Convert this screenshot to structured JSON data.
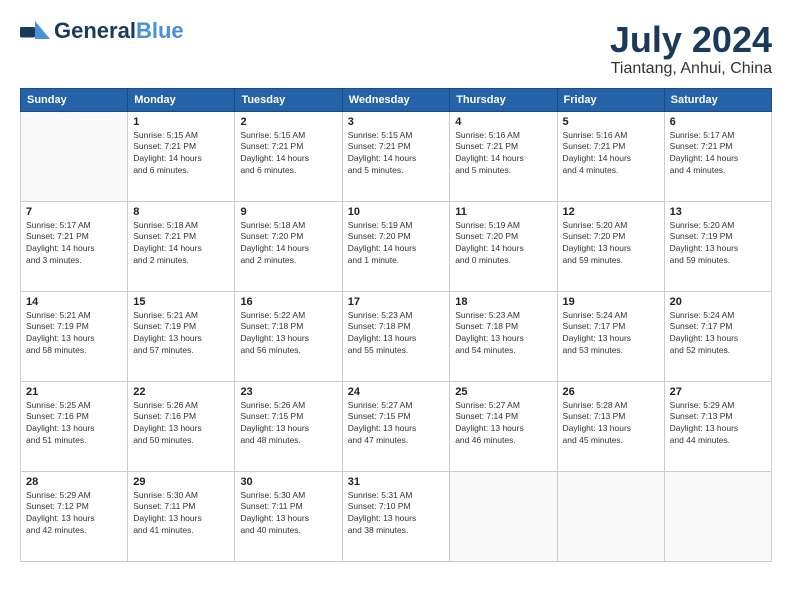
{
  "header": {
    "logo_main": "General",
    "logo_sub": "Blue",
    "month_year": "July 2024",
    "location": "Tiantang, Anhui, China"
  },
  "days_of_week": [
    "Sunday",
    "Monday",
    "Tuesday",
    "Wednesday",
    "Thursday",
    "Friday",
    "Saturday"
  ],
  "weeks": [
    [
      {
        "day": "",
        "info": ""
      },
      {
        "day": "1",
        "info": "Sunrise: 5:15 AM\nSunset: 7:21 PM\nDaylight: 14 hours\nand 6 minutes."
      },
      {
        "day": "2",
        "info": "Sunrise: 5:15 AM\nSunset: 7:21 PM\nDaylight: 14 hours\nand 6 minutes."
      },
      {
        "day": "3",
        "info": "Sunrise: 5:15 AM\nSunset: 7:21 PM\nDaylight: 14 hours\nand 5 minutes."
      },
      {
        "day": "4",
        "info": "Sunrise: 5:16 AM\nSunset: 7:21 PM\nDaylight: 14 hours\nand 5 minutes."
      },
      {
        "day": "5",
        "info": "Sunrise: 5:16 AM\nSunset: 7:21 PM\nDaylight: 14 hours\nand 4 minutes."
      },
      {
        "day": "6",
        "info": "Sunrise: 5:17 AM\nSunset: 7:21 PM\nDaylight: 14 hours\nand 4 minutes."
      }
    ],
    [
      {
        "day": "7",
        "info": "Sunrise: 5:17 AM\nSunset: 7:21 PM\nDaylight: 14 hours\nand 3 minutes."
      },
      {
        "day": "8",
        "info": "Sunrise: 5:18 AM\nSunset: 7:21 PM\nDaylight: 14 hours\nand 2 minutes."
      },
      {
        "day": "9",
        "info": "Sunrise: 5:18 AM\nSunset: 7:20 PM\nDaylight: 14 hours\nand 2 minutes."
      },
      {
        "day": "10",
        "info": "Sunrise: 5:19 AM\nSunset: 7:20 PM\nDaylight: 14 hours\nand 1 minute."
      },
      {
        "day": "11",
        "info": "Sunrise: 5:19 AM\nSunset: 7:20 PM\nDaylight: 14 hours\nand 0 minutes."
      },
      {
        "day": "12",
        "info": "Sunrise: 5:20 AM\nSunset: 7:20 PM\nDaylight: 13 hours\nand 59 minutes."
      },
      {
        "day": "13",
        "info": "Sunrise: 5:20 AM\nSunset: 7:19 PM\nDaylight: 13 hours\nand 59 minutes."
      }
    ],
    [
      {
        "day": "14",
        "info": "Sunrise: 5:21 AM\nSunset: 7:19 PM\nDaylight: 13 hours\nand 58 minutes."
      },
      {
        "day": "15",
        "info": "Sunrise: 5:21 AM\nSunset: 7:19 PM\nDaylight: 13 hours\nand 57 minutes."
      },
      {
        "day": "16",
        "info": "Sunrise: 5:22 AM\nSunset: 7:18 PM\nDaylight: 13 hours\nand 56 minutes."
      },
      {
        "day": "17",
        "info": "Sunrise: 5:23 AM\nSunset: 7:18 PM\nDaylight: 13 hours\nand 55 minutes."
      },
      {
        "day": "18",
        "info": "Sunrise: 5:23 AM\nSunset: 7:18 PM\nDaylight: 13 hours\nand 54 minutes."
      },
      {
        "day": "19",
        "info": "Sunrise: 5:24 AM\nSunset: 7:17 PM\nDaylight: 13 hours\nand 53 minutes."
      },
      {
        "day": "20",
        "info": "Sunrise: 5:24 AM\nSunset: 7:17 PM\nDaylight: 13 hours\nand 52 minutes."
      }
    ],
    [
      {
        "day": "21",
        "info": "Sunrise: 5:25 AM\nSunset: 7:16 PM\nDaylight: 13 hours\nand 51 minutes."
      },
      {
        "day": "22",
        "info": "Sunrise: 5:26 AM\nSunset: 7:16 PM\nDaylight: 13 hours\nand 50 minutes."
      },
      {
        "day": "23",
        "info": "Sunrise: 5:26 AM\nSunset: 7:15 PM\nDaylight: 13 hours\nand 48 minutes."
      },
      {
        "day": "24",
        "info": "Sunrise: 5:27 AM\nSunset: 7:15 PM\nDaylight: 13 hours\nand 47 minutes."
      },
      {
        "day": "25",
        "info": "Sunrise: 5:27 AM\nSunset: 7:14 PM\nDaylight: 13 hours\nand 46 minutes."
      },
      {
        "day": "26",
        "info": "Sunrise: 5:28 AM\nSunset: 7:13 PM\nDaylight: 13 hours\nand 45 minutes."
      },
      {
        "day": "27",
        "info": "Sunrise: 5:29 AM\nSunset: 7:13 PM\nDaylight: 13 hours\nand 44 minutes."
      }
    ],
    [
      {
        "day": "28",
        "info": "Sunrise: 5:29 AM\nSunset: 7:12 PM\nDaylight: 13 hours\nand 42 minutes."
      },
      {
        "day": "29",
        "info": "Sunrise: 5:30 AM\nSunset: 7:11 PM\nDaylight: 13 hours\nand 41 minutes."
      },
      {
        "day": "30",
        "info": "Sunrise: 5:30 AM\nSunset: 7:11 PM\nDaylight: 13 hours\nand 40 minutes."
      },
      {
        "day": "31",
        "info": "Sunrise: 5:31 AM\nSunset: 7:10 PM\nDaylight: 13 hours\nand 38 minutes."
      },
      {
        "day": "",
        "info": ""
      },
      {
        "day": "",
        "info": ""
      },
      {
        "day": "",
        "info": ""
      }
    ]
  ]
}
